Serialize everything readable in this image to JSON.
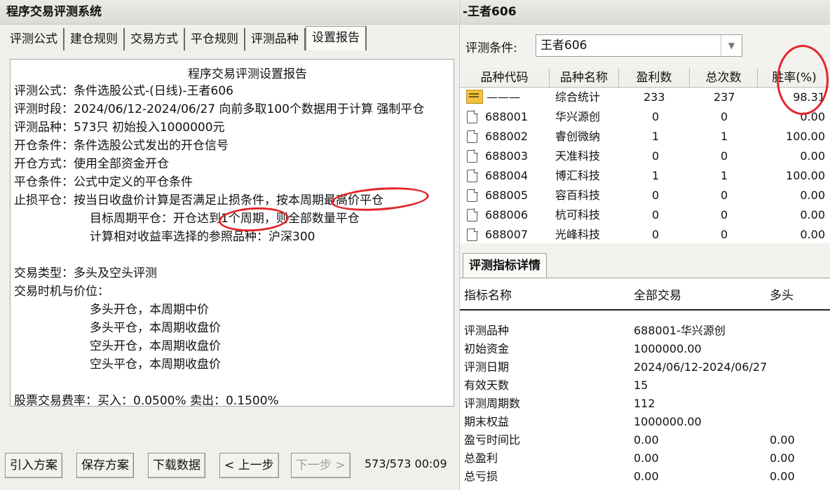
{
  "left_window": {
    "title": "程序交易评测系统",
    "tabs": [
      "评测公式",
      "建仓规则",
      "交易方式",
      "平仓规则",
      "评测品种",
      "设置报告"
    ],
    "active_tab": 5,
    "report": {
      "title": "程序交易评测设置报告",
      "lines": [
        "评测公式：条件选股公式-(日线)-王者606",
        "评测时段：2024/06/12-2024/06/27 向前多取100个数据用于计算 强制平仓",
        "评测品种：573只 初始投入1000000元",
        "开仓条件：条件选股公式发出的开仓信号",
        "开仓方式：使用全部资金开仓",
        "平仓条件：公式中定义的平仓条件",
        "止损平仓：按当日收盘价计算是否满足止损条件，按本周期最高价平仓",
        "目标周期平仓：开仓达到1个周期，则全部数量平仓",
        "计算相对收益率选择的参照品种：沪深300",
        "交易类型：多头及空头评测",
        "交易时机与价位：",
        "多头开仓，本周期中价",
        "多头平仓，本周期收盘价",
        "空头开仓，本周期收盘价",
        "空头平仓，本周期收盘价",
        "股票交易费率：买入：0.0500%   卖出：0.1500%"
      ]
    },
    "buttons": {
      "import": "引入方案",
      "save": "保存方案",
      "download": "下载数据",
      "prev": "< 上一步",
      "next": "下一步 >"
    },
    "progress": "573/573 00:09"
  },
  "right_window": {
    "title": "-王者606",
    "condition_label": "评测条件:",
    "condition_value": "王者606",
    "table": {
      "headers": [
        "品种代码",
        "品种名称",
        "盈利数",
        "总次数",
        "胜率(%)"
      ],
      "rows": [
        {
          "code": "———",
          "name": "综合统计",
          "win": "233",
          "total": "237",
          "rate": "98.31",
          "icon": "folder-icon"
        },
        {
          "code": "688001",
          "name": "华兴源创",
          "win": "0",
          "total": "0",
          "rate": "0.00",
          "icon": "document-icon"
        },
        {
          "code": "688002",
          "name": "睿创微纳",
          "win": "1",
          "total": "1",
          "rate": "100.00",
          "icon": "document-icon"
        },
        {
          "code": "688003",
          "name": "天准科技",
          "win": "0",
          "total": "0",
          "rate": "0.00",
          "icon": "document-icon"
        },
        {
          "code": "688004",
          "name": "博汇科技",
          "win": "1",
          "total": "1",
          "rate": "100.00",
          "icon": "document-icon"
        },
        {
          "code": "688005",
          "name": "容百科技",
          "win": "0",
          "total": "0",
          "rate": "0.00",
          "icon": "document-icon"
        },
        {
          "code": "688006",
          "name": "杭可科技",
          "win": "0",
          "total": "0",
          "rate": "0.00",
          "icon": "document-icon"
        },
        {
          "code": "688007",
          "name": "光峰科技",
          "win": "0",
          "total": "0",
          "rate": "0.00",
          "icon": "document-icon"
        }
      ]
    },
    "detail": {
      "tab": "评测指标详情",
      "headers": [
        "指标名称",
        "全部交易",
        "多头"
      ],
      "rows": [
        [
          "评测品种",
          "688001-华兴源创",
          ""
        ],
        [
          "初始资金",
          "1000000.00",
          ""
        ],
        [
          "评测日期",
          "2024/06/12-2024/06/27",
          ""
        ],
        [
          "有效天数",
          "15",
          ""
        ],
        [
          "评测周期数",
          "112",
          ""
        ],
        [
          "期末权益",
          "1000000.00",
          ""
        ],
        [
          "盈亏时间比",
          "0.00",
          "0.00"
        ],
        [
          "总盈利",
          "0.00",
          "0.00"
        ],
        [
          "总亏损",
          "0.00",
          "0.00"
        ]
      ]
    }
  },
  "colors": {
    "annotation": "#e2262a",
    "folder": "#f3c23a"
  }
}
